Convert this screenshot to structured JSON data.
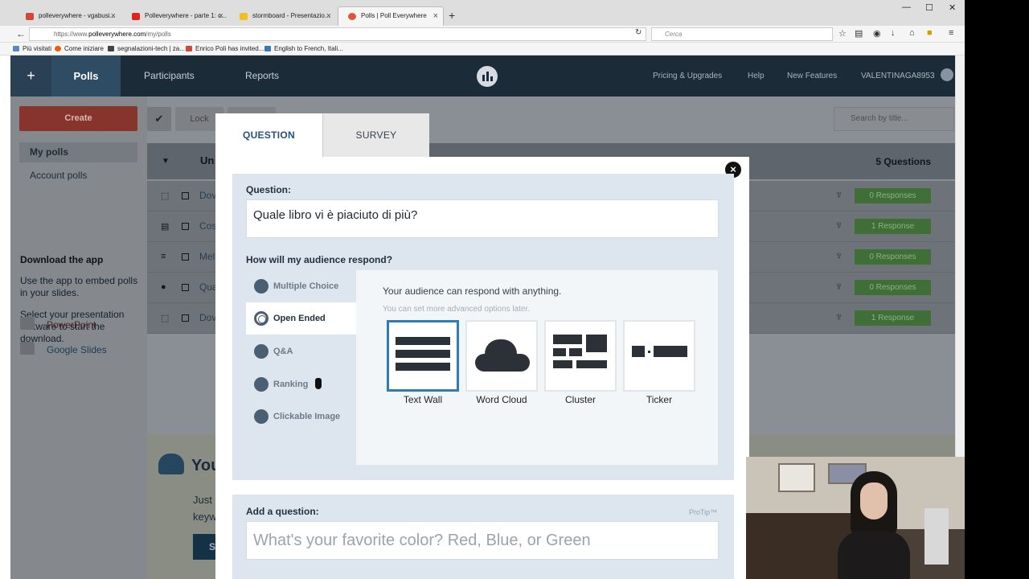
{
  "browser": {
    "tabs": [
      {
        "label": "polleverywhere - vgabusi...",
        "color": "#d44638"
      },
      {
        "label": "Polleverywhere - parte 1: c...",
        "color": "#e62117"
      },
      {
        "label": "stormboard - Presentazio...",
        "color": "#f2c01e"
      },
      {
        "label": "Polls | Poll Everywhere",
        "color": "#e0543c"
      }
    ],
    "url_prefix": "https://www.",
    "url_domain": "polleverywhere.com",
    "url_path": "/my/polls",
    "search_placeholder": "Cerca",
    "bookmarks": [
      {
        "label": "Più visitati",
        "color": "#5b86c6"
      },
      {
        "label": "Come iniziare",
        "color": "#e66000"
      },
      {
        "label": "segnalazioni-tech | za...",
        "color": "#444444"
      },
      {
        "label": "Enrico Poli has invited...",
        "color": "#d44638"
      },
      {
        "label": "English to French, Itali...",
        "color": "#3a79b8"
      }
    ]
  },
  "app": {
    "nav": {
      "plus": "+",
      "polls": "Polls",
      "participants": "Participants",
      "reports": "Reports",
      "pricing": "Pricing & Upgrades",
      "help": "Help",
      "new_features": "New Features",
      "user": "VALENTINAGA8953"
    },
    "sidebar": {
      "create": "Create",
      "my_polls": "My polls",
      "account_polls": "Account polls",
      "download_heading": "Download the app",
      "download_p1": "Use the app to embed polls in your slides.",
      "download_p2": "Select your presentation software to start the download.",
      "powerpoint": "PowerPoint",
      "google_slides": "Google Slides"
    },
    "toolbar": {
      "lock": "Lock",
      "search_placeholder": "Search by title..."
    },
    "list": {
      "group": "Un",
      "count": "5 Questions",
      "rows": [
        {
          "icon": "⬚",
          "title": "Dov",
          "response": "0 Responses"
        },
        {
          "icon": "▤",
          "title": "Cos",
          "response": "1 Response"
        },
        {
          "icon": "≡",
          "title": "Mel",
          "response": "0 Responses"
        },
        {
          "icon": "●",
          "title": "Qua",
          "response": "0 Responses"
        },
        {
          "icon": "⬚",
          "title": "Dov",
          "response": "1 Response"
        }
      ]
    },
    "banner": {
      "heading": "You",
      "p1": "Just",
      "p2": "keyw",
      "btn": "S"
    }
  },
  "modal": {
    "tab_question": "QUESTION",
    "tab_survey": "SURVEY",
    "question_label": "Question:",
    "question_value": "Quale libro vi è piaciuto di più?",
    "respond_label": "How will my audience respond?",
    "options": [
      {
        "label": "Multiple Choice"
      },
      {
        "label": "Open Ended"
      },
      {
        "label": "Q&A"
      },
      {
        "label": "Ranking"
      },
      {
        "label": "Clickable Image"
      }
    ],
    "respond_heading": "Your audience can respond with anything.",
    "respond_sub": "You can set more advanced options later.",
    "cards": [
      {
        "label": "Text Wall"
      },
      {
        "label": "Word Cloud"
      },
      {
        "label": "Cluster"
      },
      {
        "label": "Ticker"
      }
    ],
    "add_label": "Add a question:",
    "protip": "ProTip™",
    "add_placeholder": "What's your favorite color? Red, Blue, or Green"
  }
}
